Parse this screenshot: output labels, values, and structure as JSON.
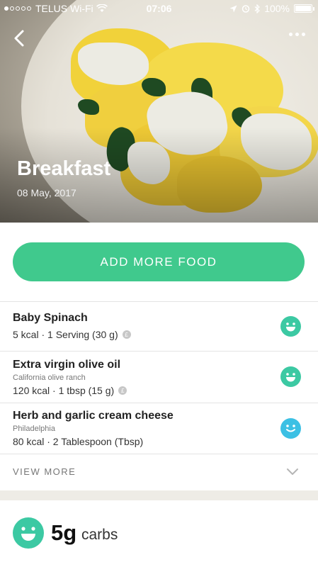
{
  "status_bar": {
    "carrier": "TELUS Wi-Fi",
    "time": "07:06",
    "battery": "100%"
  },
  "hero": {
    "title": "Breakfast",
    "date": "08 May, 2017"
  },
  "add_button": {
    "label": "ADD MORE FOOD"
  },
  "foods": [
    {
      "name": "Baby Spinach",
      "brand": "",
      "info": "5 kcal · 1 Serving (30 g)",
      "rating": "happy"
    },
    {
      "name": "Extra virgin olive oil",
      "brand": "California olive ranch",
      "info": "120 kcal · 1 tbsp (15 g)",
      "rating": "happy"
    },
    {
      "name": "Herb and garlic cream cheese",
      "brand": "Philadelphia",
      "info": "80 kcal · 2 Tablespoon (Tbsp)",
      "rating": "smile"
    }
  ],
  "view_more": {
    "label": "VIEW MORE"
  },
  "summary": {
    "value": "5g",
    "label": "carbs"
  },
  "colors": {
    "accent": "#40c98d",
    "face_green": "#3cc9a3",
    "face_blue": "#3cc0e4"
  }
}
